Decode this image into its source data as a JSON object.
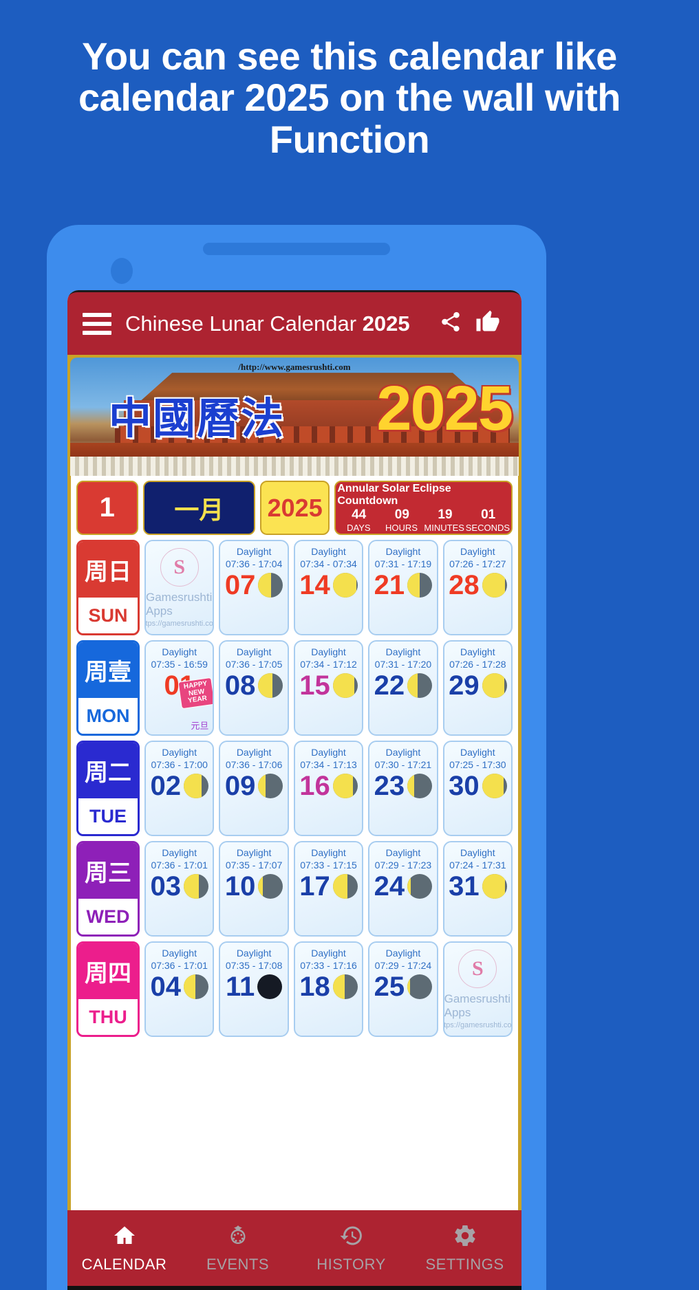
{
  "promo": {
    "headline": "You can see this calendar like calendar 2025 on the wall with Function"
  },
  "appbar": {
    "menu_icon": "hamburger-icon",
    "title_main": "Chinese Lunar Calendar",
    "title_year": "2025",
    "share_icon": "share-icon",
    "like_icon": "thumbs-up-icon"
  },
  "banner": {
    "url": "/http://www.gamesrushti.com",
    "chinese_title": "中國曆法",
    "year": "2025"
  },
  "controls": {
    "month_number": "1",
    "month_chinese": "一月",
    "year": "2025",
    "countdown": {
      "title": "Annular Solar Eclipse Countdown",
      "values": [
        "44",
        "09",
        "19",
        "01"
      ],
      "labels": [
        "DAYS",
        "HOURS",
        "MINUTES",
        "SECONDS"
      ]
    }
  },
  "colors": {
    "page_bg": "#1d5dc0",
    "appbar": "#ad2331",
    "accent_gold": "#c9a227",
    "sun": "#d93a32",
    "mon": "#1668dc",
    "tue": "#2a2ad0",
    "wed": "#8e20b8",
    "thu": "#ec1e8c"
  },
  "watermark": {
    "name": "Gamesrushti Apps",
    "link": "https://gamesrushti.com",
    "seal_glyph": "S"
  },
  "calendar": {
    "daylight_label": "Daylight",
    "rows": [
      {
        "cn": "周日",
        "en": "SUN",
        "cls": "sun",
        "cells": [
          {
            "type": "watermark"
          },
          {
            "type": "day",
            "num": "07",
            "daylight": "07:36 - 17:04",
            "num_color": "red",
            "moon": 52
          },
          {
            "type": "day",
            "num": "14",
            "daylight": "07:34 - 07:34",
            "num_color": "red",
            "moon": 96
          },
          {
            "type": "day",
            "num": "21",
            "daylight": "07:31 - 17:19",
            "num_color": "red",
            "moon": 50
          },
          {
            "type": "day",
            "num": "28",
            "daylight": "07:26 - 17:27",
            "num_color": "red",
            "moon": 92
          }
        ]
      },
      {
        "cn": "周壹",
        "en": "MON",
        "cls": "mon",
        "cells": [
          {
            "type": "day",
            "num": "01",
            "daylight": "07:35 - 16:59",
            "num_color": "red",
            "moon": -1,
            "festival": "元旦",
            "badge": "HAPPY NEW YEAR"
          },
          {
            "type": "day",
            "num": "08",
            "daylight": "07:36 - 17:05",
            "num_color": "blue",
            "moon": 58
          },
          {
            "type": "day",
            "num": "15",
            "daylight": "07:34 - 17:12",
            "num_color": "pink",
            "moon": 88
          },
          {
            "type": "day",
            "num": "22",
            "daylight": "07:31 - 17:20",
            "num_color": "blue",
            "moon": 42
          },
          {
            "type": "day",
            "num": "29",
            "daylight": "07:26 - 17:28",
            "num_color": "blue",
            "moon": 90
          }
        ]
      },
      {
        "cn": "周二",
        "en": "TUE",
        "cls": "tue",
        "cells": [
          {
            "type": "day",
            "num": "02",
            "daylight": "07:36 - 17:00",
            "num_color": "blue",
            "moon": 72
          },
          {
            "type": "day",
            "num": "09",
            "daylight": "07:36 - 17:06",
            "num_color": "blue",
            "moon": 30
          },
          {
            "type": "day",
            "num": "16",
            "daylight": "07:34 - 17:13",
            "num_color": "pink",
            "moon": 80
          },
          {
            "type": "day",
            "num": "23",
            "daylight": "07:30 - 17:21",
            "num_color": "blue",
            "moon": 26
          },
          {
            "type": "day",
            "num": "30",
            "daylight": "07:25 - 17:30",
            "num_color": "blue",
            "moon": 86
          }
        ]
      },
      {
        "cn": "周三",
        "en": "WED",
        "cls": "wed",
        "cells": [
          {
            "type": "day",
            "num": "03",
            "daylight": "07:36 - 17:01",
            "num_color": "blue",
            "moon": 62
          },
          {
            "type": "day",
            "num": "10",
            "daylight": "07:35 - 17:07",
            "num_color": "blue",
            "moon": 18
          },
          {
            "type": "day",
            "num": "17",
            "daylight": "07:33 - 17:15",
            "num_color": "blue",
            "moon": 58
          },
          {
            "type": "day",
            "num": "24",
            "daylight": "07:29 - 17:23",
            "num_color": "blue",
            "moon": 14
          },
          {
            "type": "day",
            "num": "31",
            "daylight": "07:24 - 17:31",
            "num_color": "blue",
            "moon": 94
          }
        ]
      },
      {
        "cn": "周四",
        "en": "THU",
        "cls": "thu",
        "cells": [
          {
            "type": "day",
            "num": "04",
            "daylight": "07:36 - 17:01",
            "num_color": "blue",
            "moon": 46
          },
          {
            "type": "day",
            "num": "11",
            "daylight": "07:35 - 17:08",
            "num_color": "blue",
            "moon": 0
          },
          {
            "type": "day",
            "num": "18",
            "daylight": "07:33 - 17:16",
            "num_color": "blue",
            "moon": 48
          },
          {
            "type": "day",
            "num": "25",
            "daylight": "07:29 - 17:24",
            "num_color": "blue",
            "moon": 12
          },
          {
            "type": "watermark"
          }
        ]
      }
    ]
  },
  "bottom_nav": [
    {
      "label": "CALENDAR",
      "icon": "home-icon",
      "active": true
    },
    {
      "label": "EVENTS",
      "icon": "wreath-icon",
      "active": false
    },
    {
      "label": "HISTORY",
      "icon": "clock-history-icon",
      "active": false
    },
    {
      "label": "SETTINGS",
      "icon": "gear-icon",
      "active": false
    }
  ]
}
